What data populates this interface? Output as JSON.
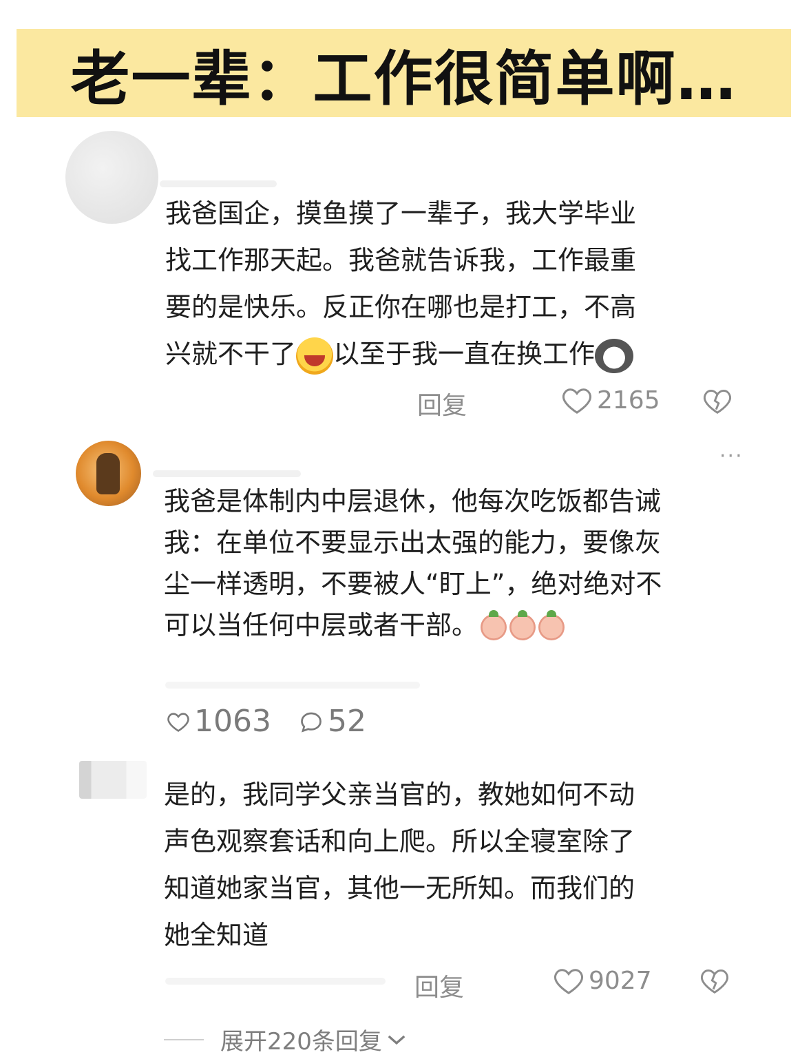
{
  "banner": {
    "title": "老一辈：工作很简单啊…"
  },
  "comments": [
    {
      "text_a": "我爸国企，摸鱼摸了一辈子，我大学毕业\n找工作那天起。我爸就告诉我，工作最重\n要的是快乐。反正你在哪也是打工，不高\n兴就不干了",
      "text_b": "以至于我一直在换工作",
      "reply_label": "回复",
      "likes": "2165"
    },
    {
      "text": "我爸是体制内中层退休，他每次吃饭都告诫\n我：在单位不要显示出太强的能力，要像灰\n尘一样透明，不要被人“盯上”，绝对绝对不\n可以当任何中层或者干部。",
      "more": "···",
      "likes": "1063",
      "comments": "52"
    },
    {
      "text": "是的，我同学父亲当官的，教她如何不动\n声色观察套话和向上爬。所以全寝室除了\n知道她家当官，其他一无所知。而我们的\n她全知道",
      "reply_label": "回复",
      "likes": "9027"
    }
  ],
  "expand": {
    "label": "展开220条回复"
  },
  "icons": {
    "heart": "heart-outline-icon",
    "dislike": "broken-heart-icon",
    "comment": "comment-bubble-icon",
    "chevron": "chevron-down-icon"
  }
}
